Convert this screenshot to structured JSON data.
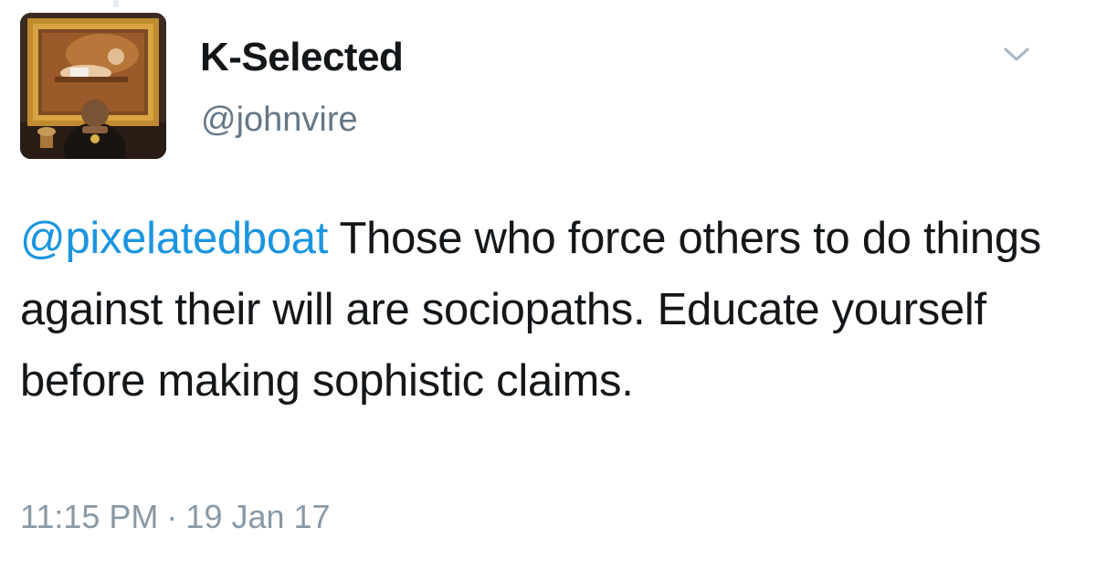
{
  "author": {
    "display_name": "K-Selected",
    "handle": "@johnvire"
  },
  "tweet": {
    "mention": "@pixelatedboat",
    "text": " Those who force others to do things against their will are sociopaths. Educate yourself before making sophistic claims."
  },
  "meta": {
    "time": "11:15 PM",
    "separator": "·",
    "date": "19 Jan 17"
  },
  "icons": {
    "menu": "chevron-down-icon"
  },
  "colors": {
    "link": "#1b95e0",
    "secondary_text": "#657786",
    "timestamp": "#8899a6"
  }
}
